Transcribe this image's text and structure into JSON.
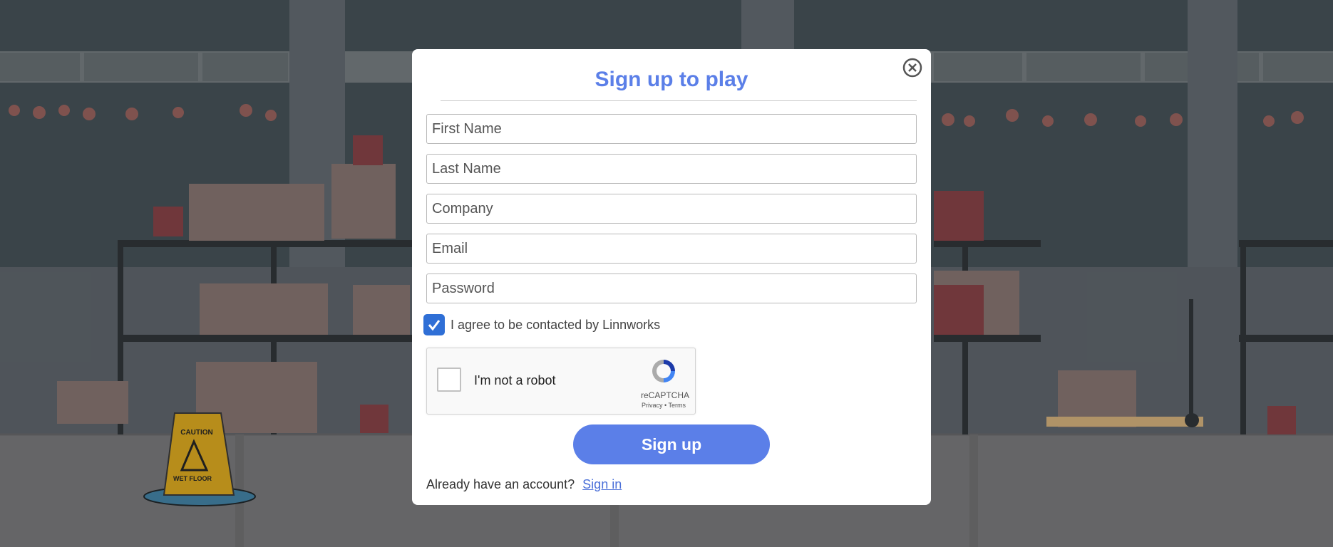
{
  "modal": {
    "title": "Sign up to play",
    "fields": [
      {
        "name": "first-name",
        "placeholder": "First Name"
      },
      {
        "name": "last-name",
        "placeholder": "Last Name"
      },
      {
        "name": "company",
        "placeholder": "Company"
      },
      {
        "name": "email",
        "placeholder": "Email"
      },
      {
        "name": "password",
        "placeholder": "Password"
      }
    ],
    "consent_label": "I agree to be contacted by Linnworks",
    "consent_checked": true,
    "captcha": {
      "label": "I'm not a robot",
      "brand": "reCAPTCHA",
      "links": "Privacy • Terms"
    },
    "signup_label": "Sign up",
    "footer_text": "Already have an account?",
    "signin_label": "Sign in"
  },
  "scene_sign": {
    "top": "CAUTION",
    "bottom": "WET FLOOR"
  },
  "colors": {
    "accent": "#5b7fe8",
    "checkbox": "#2f6fd6",
    "wall": "#404a50",
    "floor": "#6e6e70"
  }
}
